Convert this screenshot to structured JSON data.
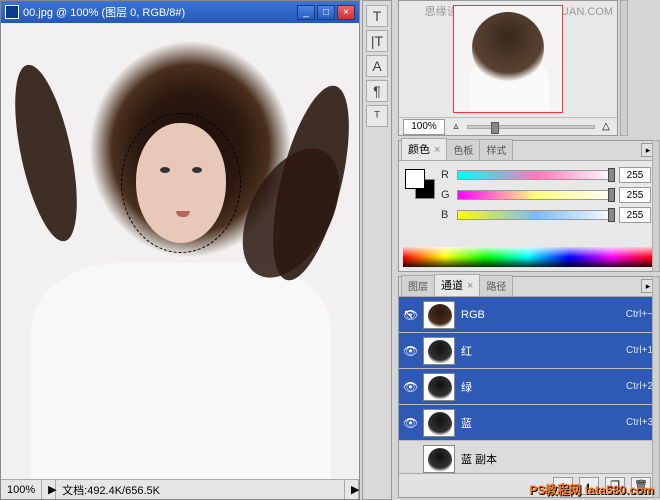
{
  "doc": {
    "title_text": "00.jpg @ 100% (图层 0, RGB/8#)",
    "icon": "ps-icon"
  },
  "win_btns": {
    "min": "_",
    "max": "□",
    "close": "×"
  },
  "statusbar": {
    "zoom": "100%",
    "doc_info": "文档:492.4K/656.5K",
    "arrow": "▶"
  },
  "type_tools": [
    "T",
    "|T",
    "A",
    "¶",
    "ᵀ"
  ],
  "navigator": {
    "zoom_pct": "100%",
    "watermark_top": "思缘设计论坛",
    "watermark_url": "WWW.MISSYUAN.COM",
    "small": "▵",
    "large": "△"
  },
  "color_panel": {
    "tabs": [
      "颜色",
      "色板",
      "样式"
    ],
    "active_tab": 0,
    "rows": [
      {
        "label": "R",
        "value": "255"
      },
      {
        "label": "G",
        "value": "255"
      },
      {
        "label": "B",
        "value": "255"
      }
    ]
  },
  "channel_panel": {
    "tabs": [
      "图层",
      "通道",
      "路径"
    ],
    "active_tab": 1,
    "rows": [
      {
        "name": "RGB",
        "shortcut": "Ctrl+~",
        "selected": true,
        "eye": true,
        "thumb": "rgb"
      },
      {
        "name": "红",
        "shortcut": "Ctrl+1",
        "selected": true,
        "eye": true,
        "thumb": "dark"
      },
      {
        "name": "绿",
        "shortcut": "Ctrl+2",
        "selected": true,
        "eye": true,
        "thumb": "dark"
      },
      {
        "name": "蓝",
        "shortcut": "Ctrl+3",
        "selected": true,
        "eye": true,
        "thumb": "dark"
      },
      {
        "name": "蓝 副本",
        "shortcut": "",
        "selected": false,
        "eye": false,
        "thumb": "dark"
      }
    ],
    "footer_icons": {
      "sel": "○",
      "new": "❐",
      "trash": "🗑"
    },
    "menu_glyph": "▸"
  },
  "watermark_bottom": "PS教程网  tata580.com",
  "eye_glyph": "👁"
}
